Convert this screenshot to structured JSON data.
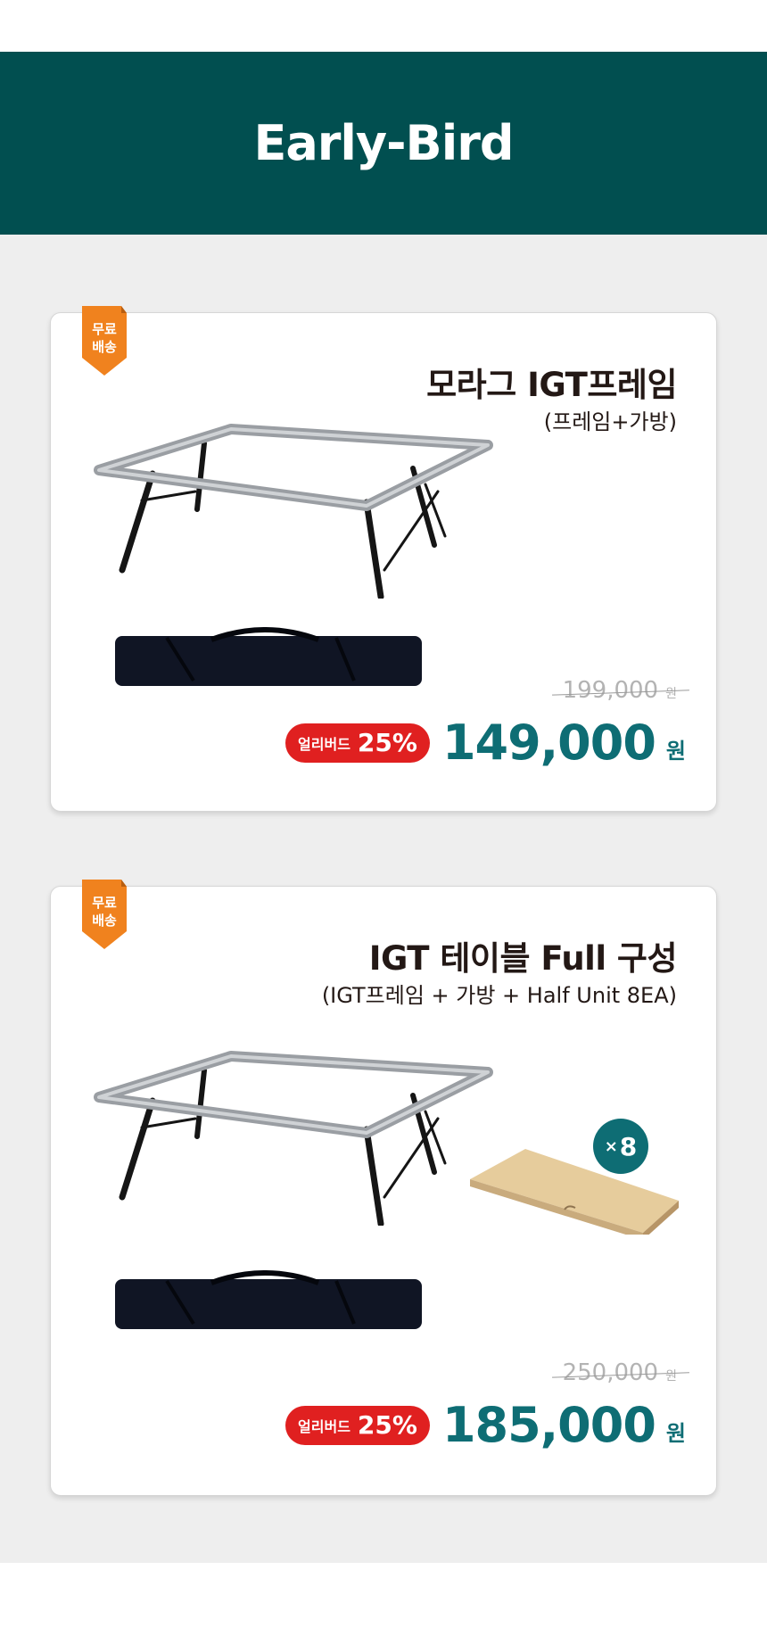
{
  "header": {
    "title": "Early-Bird"
  },
  "colors": {
    "header_bg": "#014f50",
    "accent": "#0e6d74",
    "badge": "#f0821e",
    "discount": "#e02020"
  },
  "products": [
    {
      "badge": "무료\n배송",
      "title": "모라그 IGT프레임",
      "subtitle": "(프레임+가방)",
      "original_price": "199,000",
      "original_unit": "원",
      "discount_label": "얼리버드",
      "discount_percent": "25%",
      "price": "149,000",
      "price_unit": "원"
    },
    {
      "badge": "무료\n배송",
      "title": "IGT 테이블 Full 구성",
      "subtitle": "(IGT프레임 + 가방 + Half Unit 8EA)",
      "original_price": "250,000",
      "original_unit": "원",
      "discount_label": "얼리버드",
      "discount_percent": "25%",
      "price": "185,000",
      "price_unit": "원",
      "unit_multiplier": "8"
    }
  ]
}
